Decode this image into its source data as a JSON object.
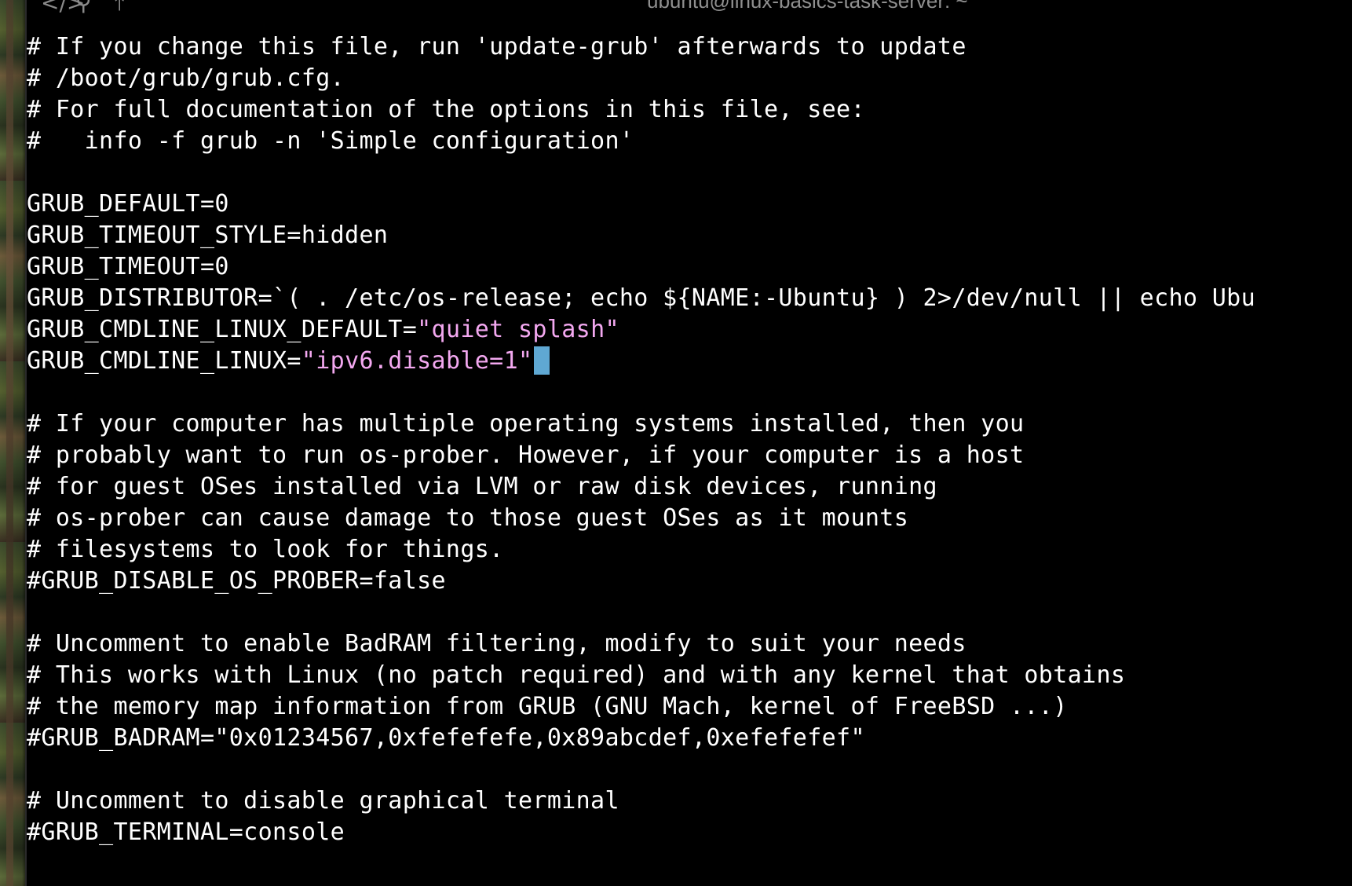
{
  "window": {
    "title": "ubuntu@linux-basics-task-server: ~",
    "toolbar_icons": [
      "code-icon",
      "search-icon",
      "upload-icon"
    ]
  },
  "editor": {
    "lines": [
      "# If you change this file, run 'update-grub' afterwards to update",
      "# /boot/grub/grub.cfg.",
      "# For full documentation of the options in this file, see:",
      "#   info -f grub -n 'Simple configuration'",
      "",
      "GRUB_DEFAULT=0",
      "GRUB_TIMEOUT_STYLE=hidden",
      "GRUB_TIMEOUT=0",
      "GRUB_DISTRIBUTOR=`( . /etc/os-release; echo ${NAME:-Ubuntu} ) 2>/dev/null || echo Ubu",
      "GRUB_CMDLINE_LINUX_DEFAULT=\"quiet splash\"",
      "GRUB_CMDLINE_LINUX=\"ipv6.disable=1\"",
      "",
      "# If your computer has multiple operating systems installed, then you",
      "# probably want to run os-prober. However, if your computer is a host",
      "# for guest OSes installed via LVM or raw disk devices, running",
      "# os-prober can cause damage to those guest OSes as it mounts",
      "# filesystems to look for things.",
      "#GRUB_DISABLE_OS_PROBER=false",
      "",
      "# Uncomment to enable BadRAM filtering, modify to suit your needs",
      "# This works with Linux (no patch required) and with any kernel that obtains",
      "# the memory map information from GRUB (GNU Mach, kernel of FreeBSD ...)",
      "#GRUB_BADRAM=\"0x01234567,0xfefefefe,0x89abcdef,0xefefefef\"",
      "",
      "# Uncomment to disable graphical terminal",
      "#GRUB_TERMINAL=console"
    ],
    "cmdline_default_key": "GRUB_CMDLINE_LINUX_DEFAULT=",
    "cmdline_default_value": "\"quiet splash\"",
    "cmdline_linux_key": "GRUB_CMDLINE_LINUX=",
    "cmdline_linux_value": "\"ipv6.disable=1\""
  },
  "colors": {
    "background": "#000000",
    "text": "#ffffff",
    "string": "#f3a8f0",
    "cursor": "#5fa8d3",
    "title": "#8f8f8f"
  }
}
